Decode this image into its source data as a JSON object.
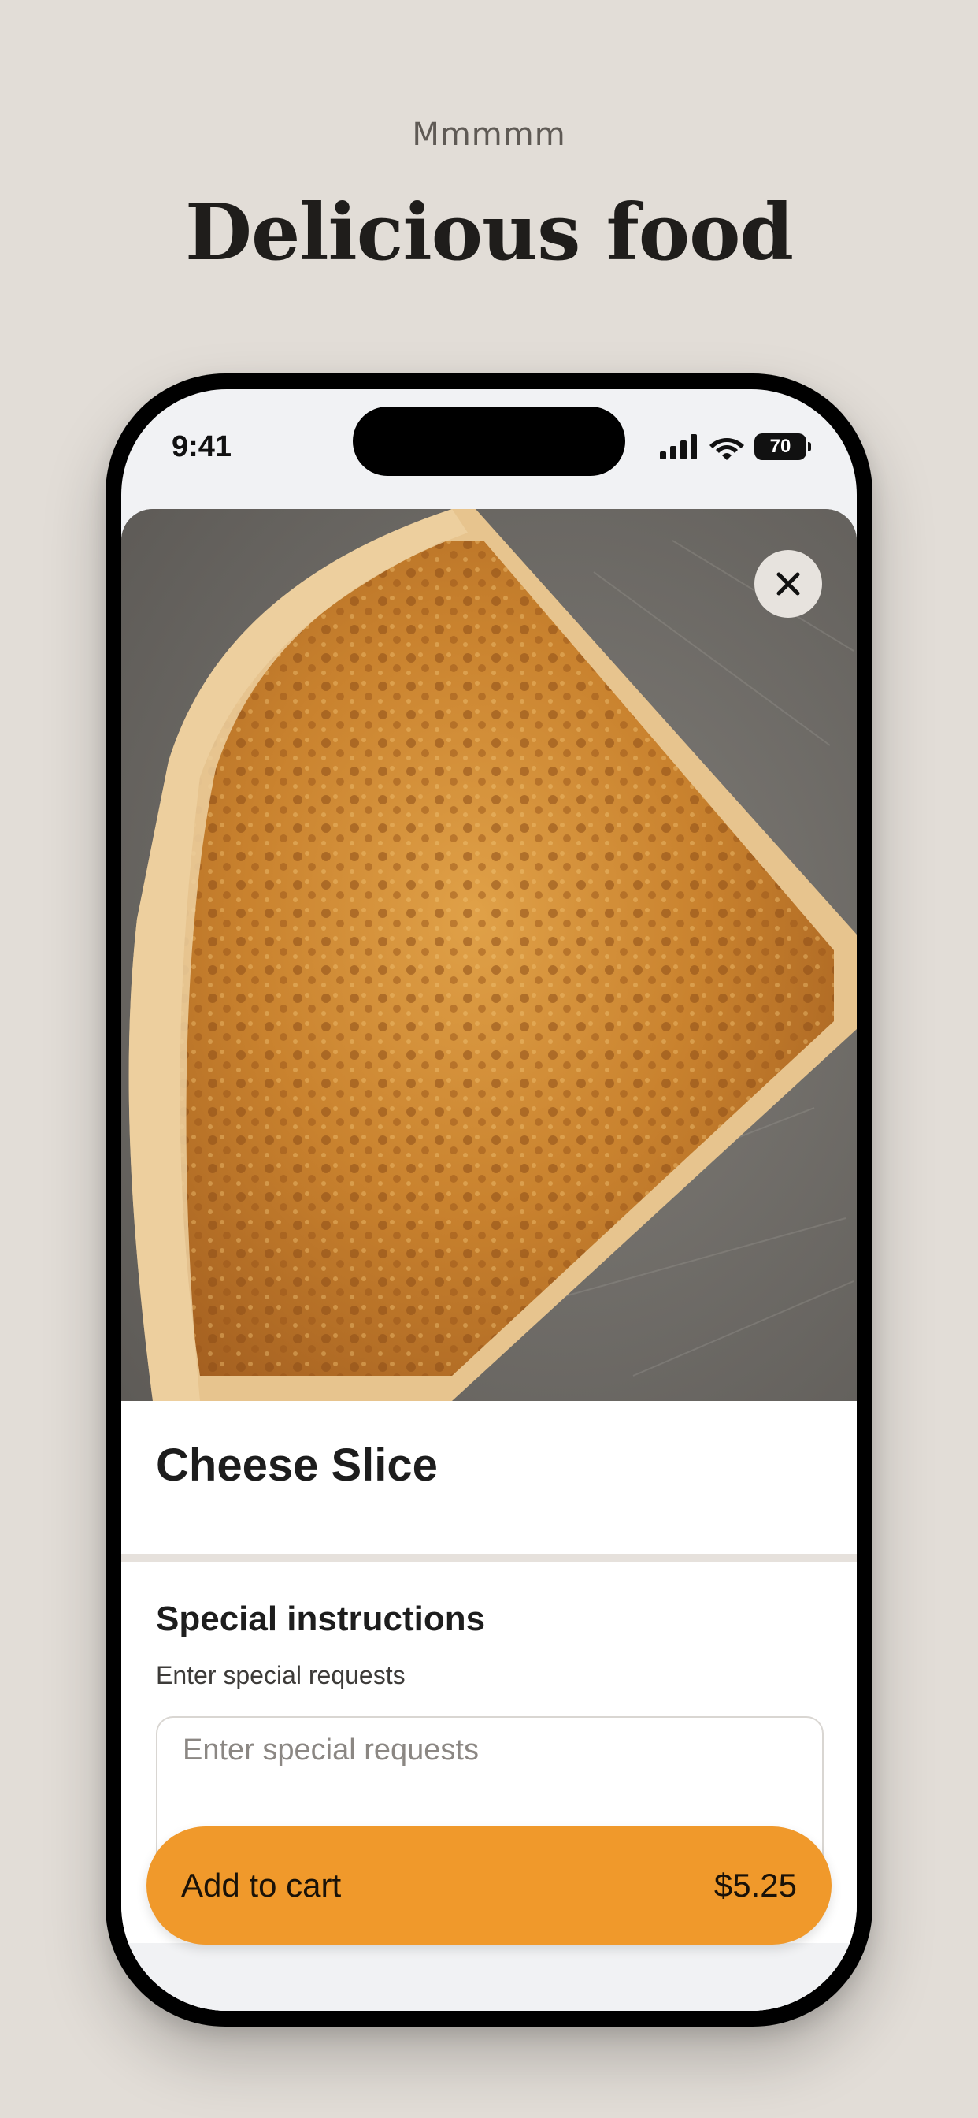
{
  "header": {
    "eyebrow": "Mmmmm",
    "headline": "Delicious food"
  },
  "status_bar": {
    "time": "9:41",
    "battery": "70",
    "icons": [
      "signal-icon",
      "wifi-icon",
      "battery-icon"
    ]
  },
  "item": {
    "photo_subject": "pizza slice photo",
    "title": "Cheese Slice"
  },
  "special_instructions": {
    "title": "Special instructions",
    "subtitle": "Enter special requests",
    "placeholder": "Enter special requests",
    "value": ""
  },
  "cart_button": {
    "label": "Add to cart",
    "price": "$5.25"
  },
  "colors": {
    "background": "#e2ddd7",
    "accent": "#f0992b",
    "text": "#1d1d1d"
  }
}
